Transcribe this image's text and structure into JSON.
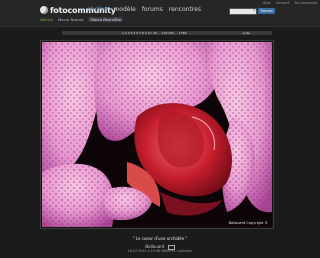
{
  "brand": {
    "name": "fotocommunity",
    "logo_icon": "fotocommunity-logo-icon"
  },
  "nav": {
    "items": [
      "photos",
      "modèle",
      "forums",
      "rencontres"
    ],
    "active": "photos"
  },
  "account": {
    "links": [
      "Aide",
      "Contact",
      "Se connecter"
    ]
  },
  "search": {
    "placeholder": "",
    "button": "Trouver"
  },
  "subnav": {
    "items": [
      "Nature",
      "Macro Nature",
      "Macro fleurs/Bio"
    ]
  },
  "pagination": {
    "pages": "1 2 3 4 5 6 7 8 9 10",
    "more": "20 ... 100 200 ... 1766",
    "next": "suite"
  },
  "photo": {
    "watermark": "Ballouard Copyright ©"
  },
  "caption": "\" Le coeur d'une orchidée \"",
  "author": {
    "name": "Ballouard"
  },
  "meta": "16.07.2012 à 19:48 Weiterer, Lorenzen"
}
